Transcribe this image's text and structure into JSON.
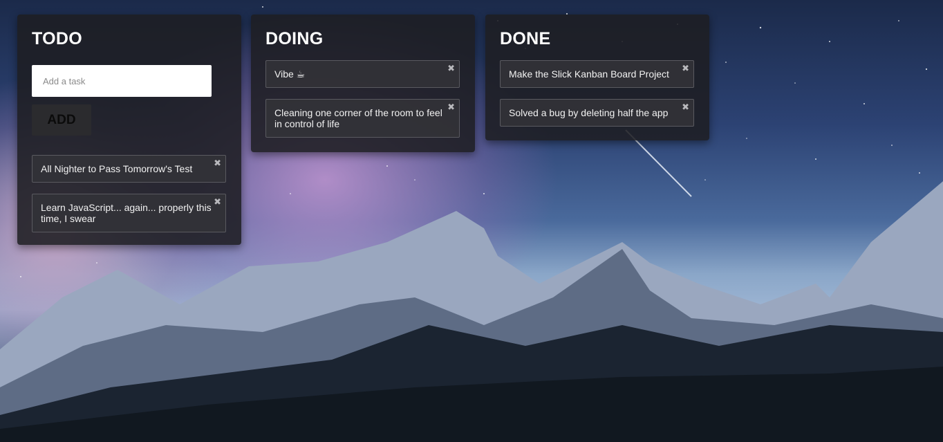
{
  "columns": {
    "todo": {
      "title": "TODO",
      "input_placeholder": "Add a task",
      "add_label": "ADD",
      "cards": [
        "All Nighter to Pass Tomorrow's Test",
        "Learn JavaScript... again... properly this time, I swear"
      ]
    },
    "doing": {
      "title": "DOING",
      "cards": [
        "Vibe ☕",
        "Cleaning one corner of the room to feel in control of life"
      ]
    },
    "done": {
      "title": "DONE",
      "cards": [
        "Make the Slick Kanban Board Project",
        "Solved a bug by deleting half the app"
      ]
    }
  },
  "icons": {
    "close": "close-icon"
  },
  "colors": {
    "panel_bg": "#1e1e22",
    "card_bg": "#323237",
    "card_border": "#5a5a60",
    "text": "#f2f2f2",
    "add_button_bg": "#2b2b2e"
  }
}
